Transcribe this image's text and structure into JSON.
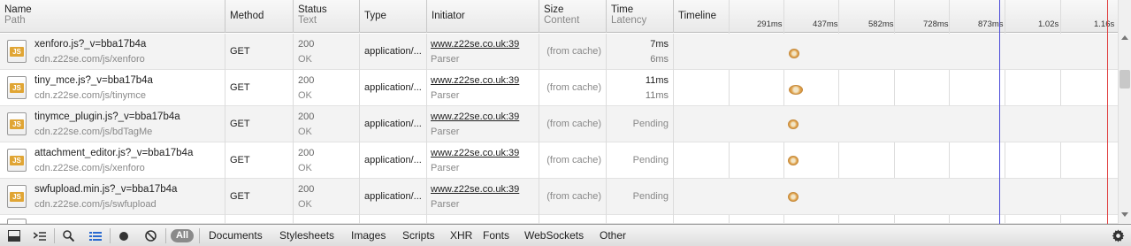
{
  "columns": {
    "name": {
      "title": "Name",
      "sub": "Path"
    },
    "method": {
      "title": "Method"
    },
    "status": {
      "title": "Status",
      "sub": "Text"
    },
    "type": {
      "title": "Type"
    },
    "initiator": {
      "title": "Initiator"
    },
    "size": {
      "title": "Size",
      "sub": "Content"
    },
    "time": {
      "title": "Time",
      "sub": "Latency"
    },
    "timeline": {
      "title": "Timeline"
    }
  },
  "timeline_ticks": [
    "291ms",
    "437ms",
    "582ms",
    "728ms",
    "873ms",
    "1.02s",
    "1.16s"
  ],
  "rows": [
    {
      "name": "xenforo.js?_v=bba17b4a",
      "path": "cdn.z22se.com/js/xenforo",
      "method": "GET",
      "status": "200",
      "status_text": "OK",
      "type": "application/...",
      "initiator": "www.z22se.co.uk:39",
      "initiator_type": "Parser",
      "size": "(from cache)",
      "time": "7ms",
      "latency": "6ms",
      "icon": "js-file-icon"
    },
    {
      "name": "tiny_mce.js?_v=bba17b4a",
      "path": "cdn.z22se.com/js/tinymce",
      "method": "GET",
      "status": "200",
      "status_text": "OK",
      "type": "application/...",
      "initiator": "www.z22se.co.uk:39",
      "initiator_type": "Parser",
      "size": "(from cache)",
      "time": "11ms",
      "latency": "11ms",
      "icon": "js-file-icon"
    },
    {
      "name": "tinymce_plugin.js?_v=bba17b4a",
      "path": "cdn.z22se.com/js/bdTagMe",
      "method": "GET",
      "status": "200",
      "status_text": "OK",
      "type": "application/...",
      "initiator": "www.z22se.co.uk:39",
      "initiator_type": "Parser",
      "size": "(from cache)",
      "time": "Pending",
      "latency": "",
      "icon": "js-file-icon"
    },
    {
      "name": "attachment_editor.js?_v=bba17b4a",
      "path": "cdn.z22se.com/js/xenforo",
      "method": "GET",
      "status": "200",
      "status_text": "OK",
      "type": "application/...",
      "initiator": "www.z22se.co.uk:39",
      "initiator_type": "Parser",
      "size": "(from cache)",
      "time": "Pending",
      "latency": "",
      "icon": "js-file-icon"
    },
    {
      "name": "swfupload.min.js?_v=bba17b4a",
      "path": "cdn.z22se.com/js/swfupload",
      "method": "GET",
      "status": "200",
      "status_text": "OK",
      "type": "application/...",
      "initiator": "www.z22se.co.uk:39",
      "initiator_type": "Parser",
      "size": "(from cache)",
      "time": "Pending",
      "latency": "",
      "icon": "js-file-icon"
    }
  ],
  "toolbar": {
    "filter_all": "All",
    "filters": [
      "Documents",
      "Stylesheets",
      "Images",
      "Scripts",
      "XHR",
      "Fonts",
      "WebSockets",
      "Other"
    ]
  },
  "colors": {
    "dom_content_line": "#4a4ad8",
    "load_line": "#e04040",
    "bar": "#e0a34c"
  }
}
